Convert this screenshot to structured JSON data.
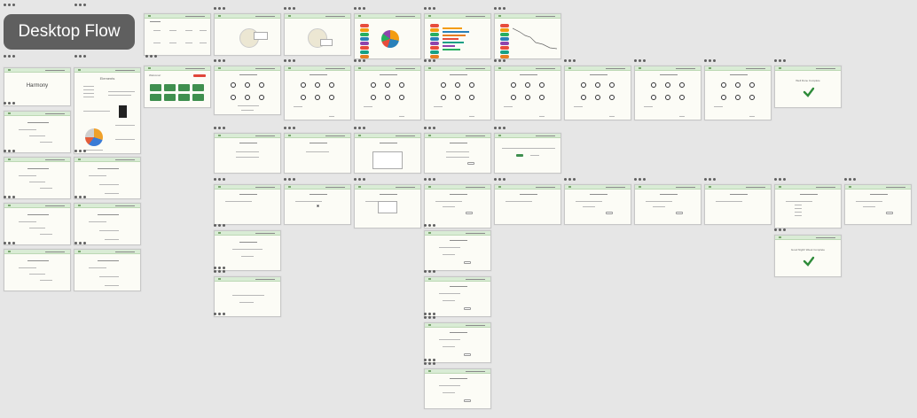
{
  "flow": {
    "label": "Desktop Flow"
  },
  "screens": {
    "harmony": {
      "title": "Harmony"
    },
    "elements": {
      "title": "Elements"
    },
    "welcome": {
      "title": "Welcome!"
    },
    "survey_complete": {
      "title": "Well Done Complete"
    },
    "sleep_complete": {
      "title": "Good Night! Week Complete"
    }
  },
  "colors": {
    "background": "#e6e6e6",
    "label_bg": "#5f5f5f",
    "screen_bg": "#fcfcf6",
    "header_green": "#d9ecd5",
    "accent_green": "#3f8f4f",
    "check_green": "#2e8b3a"
  }
}
